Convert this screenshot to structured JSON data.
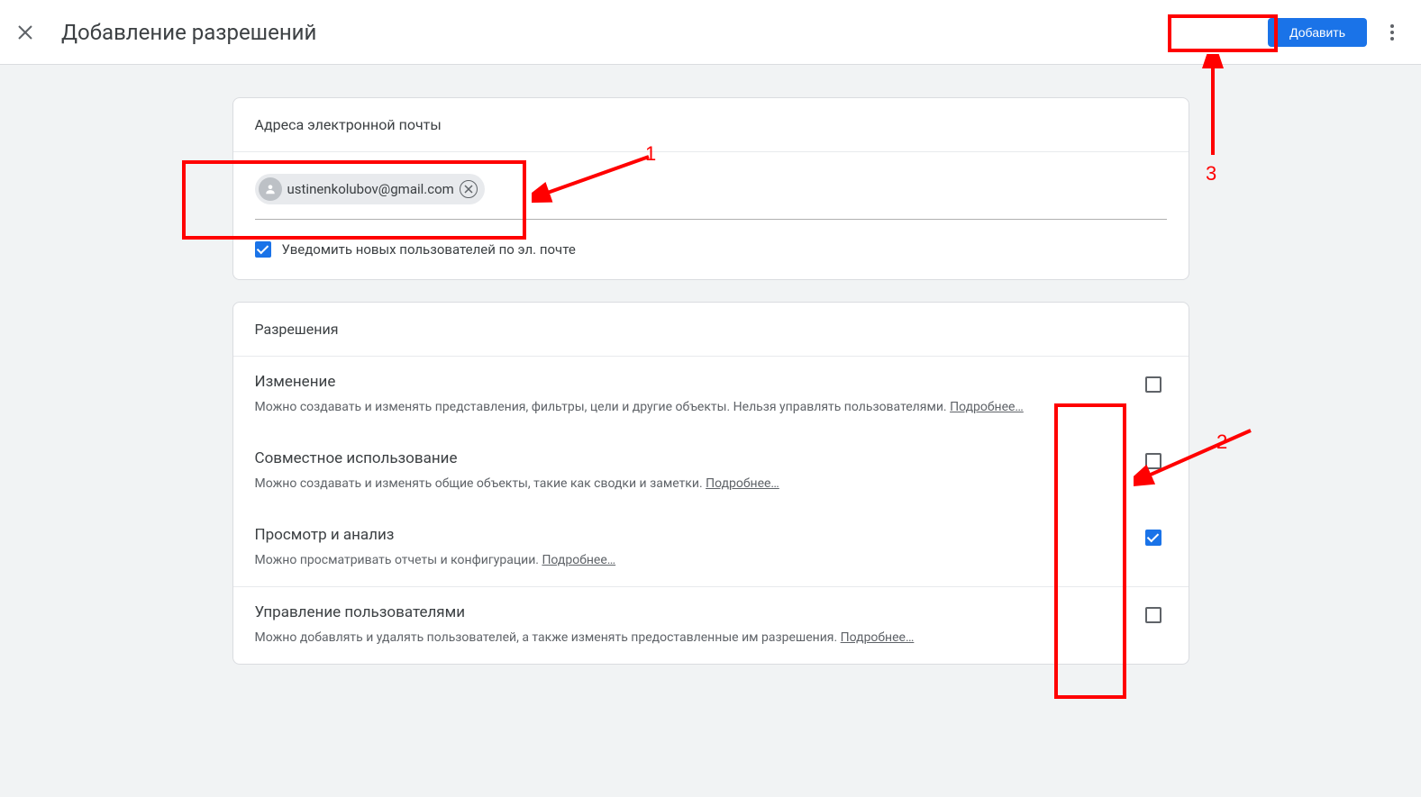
{
  "header": {
    "title": "Добавление разрешений",
    "add_button": "Добавить"
  },
  "email_card": {
    "title": "Адреса электронной почты",
    "chip_email": "ustinenkolubov@gmail.com",
    "notify_label": "Уведомить новых пользователей по эл. почте",
    "notify_checked": true
  },
  "perm_card": {
    "title": "Разрешения",
    "more_link": "Подробнее…",
    "items": [
      {
        "title": "Изменение",
        "desc": "Можно создавать и изменять представления, фильтры, цели и другие объекты. Нельзя управлять пользователями.",
        "checked": false
      },
      {
        "title": "Совместное использование",
        "desc": "Можно создавать и изменять общие объекты, такие как сводки и заметки.",
        "checked": false
      },
      {
        "title": "Просмотр и анализ",
        "desc": "Можно просматривать отчеты и конфигурации.",
        "checked": true
      },
      {
        "title": "Управление пользователями",
        "desc": "Можно добавлять и удалять пользователей, а также изменять предоставленные им разрешения.",
        "checked": false
      }
    ]
  },
  "annotations": {
    "n1": "1",
    "n2": "2",
    "n3": "3"
  }
}
